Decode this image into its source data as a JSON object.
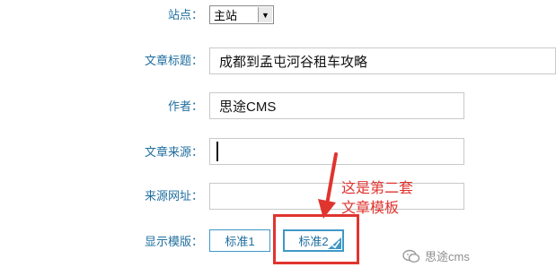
{
  "form": {
    "site_label": "站点：",
    "site_value": "主站",
    "title_label": "文章标题：",
    "title_value": "成都到孟屯河谷租车攻略",
    "author_label": "作者：",
    "author_value": "思途CMS",
    "source_label": "文章来源：",
    "source_value": "",
    "source_url_label": "来源网址：",
    "source_url_value": "",
    "template_label": "显示模版：",
    "templates": [
      "标准1",
      "标准2"
    ],
    "selected_template": "标准2"
  },
  "annotation": {
    "line1": "这是第二套",
    "line2": "文章模板",
    "color": "#e0342f"
  },
  "watermark": {
    "text": "思途cms",
    "icon": "wechat-icon"
  }
}
